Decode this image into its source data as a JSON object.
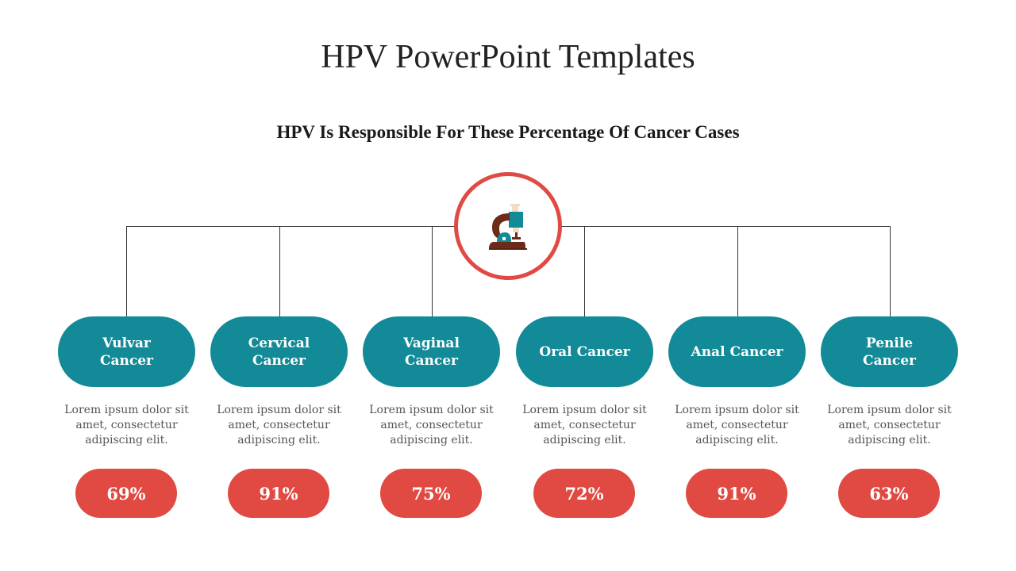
{
  "title": "HPV PowerPoint Templates",
  "subtitle": "HPV Is Responsible For These Percentage Of Cancer Cases",
  "center_icon": "microscope-icon",
  "colors": {
    "teal": "#138a97",
    "red": "#e04a42",
    "brown": "#6b2a1a",
    "cream": "#f3dcc2"
  },
  "items": [
    {
      "label": "Vulvar Cancer",
      "description": "Lorem ipsum dolor sit amet, consectetur adipiscing elit.",
      "percent": "69%"
    },
    {
      "label": "Cervical Cancer",
      "description": "Lorem ipsum dolor sit amet, consectetur adipiscing elit.",
      "percent": "91%"
    },
    {
      "label": "Vaginal Cancer",
      "description": "Lorem ipsum dolor sit amet, consectetur adipiscing elit.",
      "percent": "75%"
    },
    {
      "label": "Oral Cancer",
      "description": "Lorem ipsum dolor sit amet, consectetur adipiscing elit.",
      "percent": "72%"
    },
    {
      "label": "Anal Cancer",
      "description": "Lorem ipsum dolor sit amet, consectetur adipiscing elit.",
      "percent": "91%"
    },
    {
      "label": "Penile Cancer",
      "description": "Lorem ipsum dolor sit amet, consectetur adipiscing elit.",
      "percent": "63%"
    }
  ]
}
